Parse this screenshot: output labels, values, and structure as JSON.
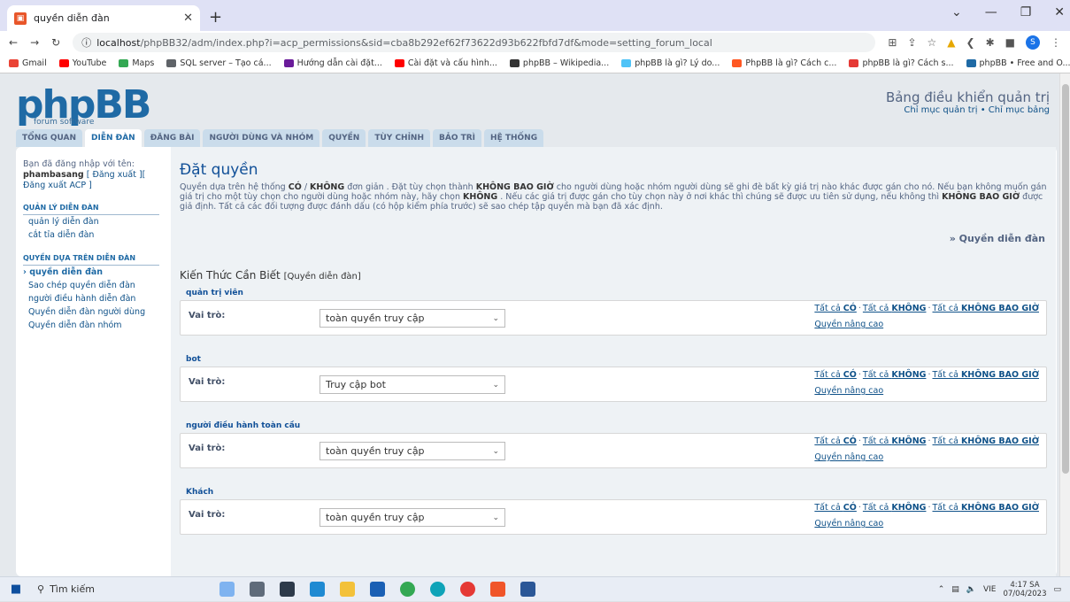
{
  "browser": {
    "tab_title": "quyền diễn đàn",
    "new_tab": "+",
    "url_host": "localhost",
    "url_path": "/phpBB32/adm/index.php?i=acp_permissions&sid=cba8b292ef62f73622d93b622fbfd7df&mode=setting_forum_local",
    "bookmarks": [
      {
        "label": "Gmail",
        "color": "#ea4335"
      },
      {
        "label": "YouTube",
        "color": "#ff0000"
      },
      {
        "label": "Maps",
        "color": "#34a853"
      },
      {
        "label": "SQL server – Tạo cá...",
        "color": "#5f6368"
      },
      {
        "label": "Hướng dẫn cài đặt...",
        "color": "#6a1b9a"
      },
      {
        "label": "Cài đặt và cấu hình...",
        "color": "#ff0000"
      },
      {
        "label": "phpBB – Wikipedia...",
        "color": "#333333"
      },
      {
        "label": "phpBB là gì? Lý do...",
        "color": "#4fc3f7"
      },
      {
        "label": "PhpBB là gì? Cách c...",
        "color": "#ff5722"
      },
      {
        "label": "phpBB là gì? Cách s...",
        "color": "#e53935"
      },
      {
        "label": "phpBB • Free and O...",
        "color": "#1f6aa5"
      }
    ]
  },
  "acp": {
    "logo": "phpBB",
    "logo_sub": "forum software",
    "title": "Bảng điều khiển quản trị",
    "header_links": "Chỉ mục quản trị • Chỉ mục bảng",
    "tabs": [
      {
        "label": "TỔNG QUAN",
        "active": false
      },
      {
        "label": "DIỄN ĐÀN",
        "active": true
      },
      {
        "label": "ĐĂNG BÀI",
        "active": false
      },
      {
        "label": "NGƯỜI DÙNG VÀ NHÓM",
        "active": false
      },
      {
        "label": "QUYỀN",
        "active": false
      },
      {
        "label": "TÙY CHỈNH",
        "active": false
      },
      {
        "label": "BẢO TRÌ",
        "active": false
      },
      {
        "label": "HỆ THỐNG",
        "active": false
      }
    ],
    "sidebar": {
      "login_prefix": "Bạn đã đăng nhập với tên:",
      "username": "phambasang",
      "logout": "[ Đăng xuất ][",
      "logout_acp": "Đăng xuất ACP ]",
      "section1": "QUẢN LÝ DIỄN ĐÀN",
      "items1": [
        "quản lý diễn đàn",
        "cắt tỉa diễn đàn"
      ],
      "section2": "QUYỀN DỰA TRÊN DIỄN ĐÀN",
      "items2": [
        "› quyền diễn đàn",
        "Sao chép quyền diễn đàn",
        "người điều hành diễn đàn",
        "Quyền diễn đàn người dùng",
        "Quyền diễn đàn nhóm"
      ]
    },
    "main": {
      "heading": "Đặt quyền",
      "intro_1": "Quyền dựa trên hệ thống ",
      "intro_co": "CÓ",
      "intro_slash": " / ",
      "intro_khong": "KHÔNG",
      "intro_2": " đơn giản . Đặt tùy chọn thành ",
      "intro_kbg": "KHÔNG BAO GIỜ",
      "intro_3": " cho người dùng hoặc nhóm người dùng sẽ ghi đè bất kỳ giá trị nào khác được gán cho nó. Nếu bạn không muốn gán giá trị cho một tùy chọn cho người dùng hoặc nhóm này, hãy chọn ",
      "intro_khong2": "KHÔNG",
      "intro_4": " . Nếu các giá trị được gán cho tùy chọn này ở nơi khác thì chúng sẽ được ưu tiên sử dụng, nếu không thì ",
      "intro_kbg2": "KHÔNG BAO GIỜ",
      "intro_5": " được giả định. Tất cả các đối tượng được đánh dấu (có hộp kiểm phía trước) sẽ sao chép tập quyền mà bạn đã xác định.",
      "crumb": "» Quyền diễn đàn",
      "section_title": "Kiến Thức Cần Biết",
      "section_sub": "[Quyền diễn đàn]",
      "role_label": "Vai trò:",
      "link_all_co_prefix": "Tất cả ",
      "link_co": "CÓ",
      "link_khong": "KHÔNG",
      "link_kbg": "KHÔNG BAO GIỜ",
      "link_sep": "·",
      "link_adv": "Quyền nâng cao",
      "groups": [
        {
          "name": "quản trị viên",
          "role": "toàn quyền truy cập"
        },
        {
          "name": "bot",
          "role": "Truy cập bot"
        },
        {
          "name": "người điều hành toàn cầu",
          "role": "toàn quyền truy cập"
        },
        {
          "name": "Khách",
          "role": "toàn quyền truy cập"
        }
      ]
    }
  },
  "taskbar": {
    "search": "Tìm kiếm",
    "lang": "VIE",
    "time": "4:17 SA",
    "date": "07/04/2023"
  }
}
